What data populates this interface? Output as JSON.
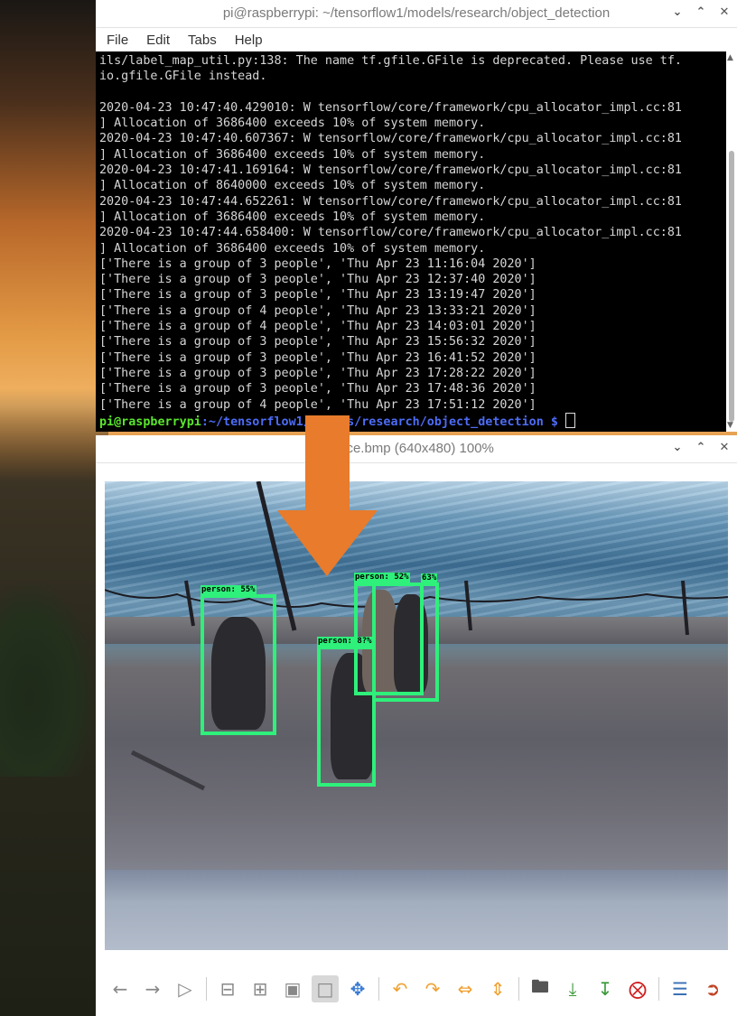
{
  "terminal": {
    "title": "pi@raspberrypi: ~/tensorflow1/models/research/object_detection",
    "menu": [
      "File",
      "Edit",
      "Tabs",
      "Help"
    ],
    "lines": [
      "ils/label_map_util.py:138: The name tf.gfile.GFile is deprecated. Please use tf.",
      "io.gfile.GFile instead.",
      "",
      "2020-04-23 10:47:40.429010: W tensorflow/core/framework/cpu_allocator_impl.cc:81",
      "] Allocation of 3686400 exceeds 10% of system memory.",
      "2020-04-23 10:47:40.607367: W tensorflow/core/framework/cpu_allocator_impl.cc:81",
      "] Allocation of 3686400 exceeds 10% of system memory.",
      "2020-04-23 10:47:41.169164: W tensorflow/core/framework/cpu_allocator_impl.cc:81",
      "] Allocation of 8640000 exceeds 10% of system memory.",
      "2020-04-23 10:47:44.652261: W tensorflow/core/framework/cpu_allocator_impl.cc:81",
      "] Allocation of 3686400 exceeds 10% of system memory.",
      "2020-04-23 10:47:44.658400: W tensorflow/core/framework/cpu_allocator_impl.cc:81",
      "] Allocation of 3686400 exceeds 10% of system memory.",
      "['There is a group of 3 people', 'Thu Apr 23 11:16:04 2020']",
      "['There is a group of 3 people', 'Thu Apr 23 12:37:40 2020']",
      "['There is a group of 3 people', 'Thu Apr 23 13:19:47 2020']",
      "['There is a group of 4 people', 'Thu Apr 23 13:33:21 2020']",
      "['There is a group of 4 people', 'Thu Apr 23 14:03:01 2020']",
      "['There is a group of 3 people', 'Thu Apr 23 15:56:32 2020']",
      "['There is a group of 3 people', 'Thu Apr 23 16:41:52 2020']",
      "['There is a group of 3 people', 'Thu Apr 23 17:28:22 2020']",
      "['There is a group of 3 people', 'Thu Apr 23 17:48:36 2020']",
      "['There is a group of 4 people', 'Thu Apr 23 17:51:12 2020']"
    ],
    "prompt_user": "pi@raspberrypi",
    "prompt_path": ":~/tensorflow1/models/research/object_detection $ "
  },
  "viewer": {
    "title": "nce.bmp (640x480) 100%",
    "detections": [
      {
        "label": "person: 55%"
      },
      {
        "label": "person: 52%"
      },
      {
        "label": "63%"
      },
      {
        "label": "person: 8?%"
      }
    ],
    "toolbar_icons": [
      "back-icon",
      "forward-icon",
      "play-icon",
      "zoom-out-icon",
      "zoom-in-icon",
      "zoom-fit-icon",
      "zoom-100-icon",
      "fullscreen-icon",
      "rotate-left-icon",
      "rotate-right-icon",
      "flip-horizontal-icon",
      "flip-vertical-icon",
      "open-icon",
      "save-icon",
      "save-as-icon",
      "delete-icon",
      "preferences-icon",
      "exit-icon"
    ]
  },
  "colors": {
    "bbox": "#2ef07a",
    "arrow": "#e87b2c",
    "prompt_user": "#5ae62d",
    "prompt_path": "#4d6cf5"
  }
}
